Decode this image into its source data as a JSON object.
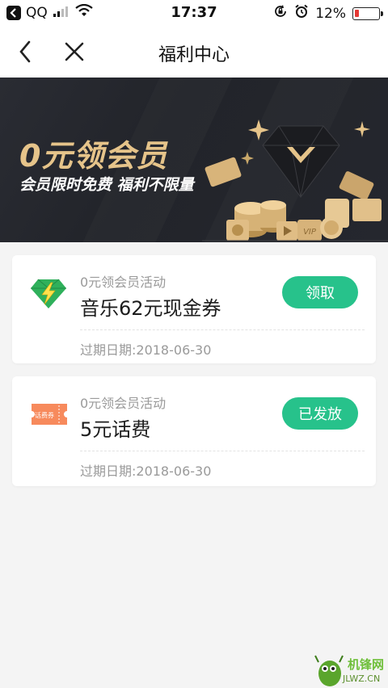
{
  "status_bar": {
    "carrier": "QQ",
    "time": "17:37",
    "battery": "12%",
    "battery_level": 0.12,
    "icons": [
      "back-badge-icon",
      "signal-icon",
      "wifi-icon",
      "rotation-lock-icon",
      "alarm-icon",
      "battery-icon"
    ]
  },
  "nav": {
    "title": "福利中心",
    "back_icon": "chevron-left-icon",
    "close_icon": "close-icon"
  },
  "banner": {
    "title": "0元领会员",
    "subtitle": "会员限时免费 福利不限量",
    "art_label": "VIP",
    "accent": "#e6c48a",
    "background": "#25272e"
  },
  "cards": [
    {
      "icon": "lightning-diamond-icon",
      "subtitle": "0元领会员活动",
      "title": "音乐62元现金券",
      "button": "领取",
      "expiry": "过期日期:2018-06-30"
    },
    {
      "icon": "phone-bill-ticket-icon",
      "icon_text": "话费券",
      "subtitle": "0元领会员活动",
      "title": "5元话费",
      "button": "已发放",
      "expiry": "过期日期:2018-06-30"
    }
  ],
  "colors": {
    "button_green": "#27c28b",
    "page_background": "#f4f4f4"
  },
  "watermark": {
    "text": "机锋网",
    "url": "JLWZ.CN"
  }
}
